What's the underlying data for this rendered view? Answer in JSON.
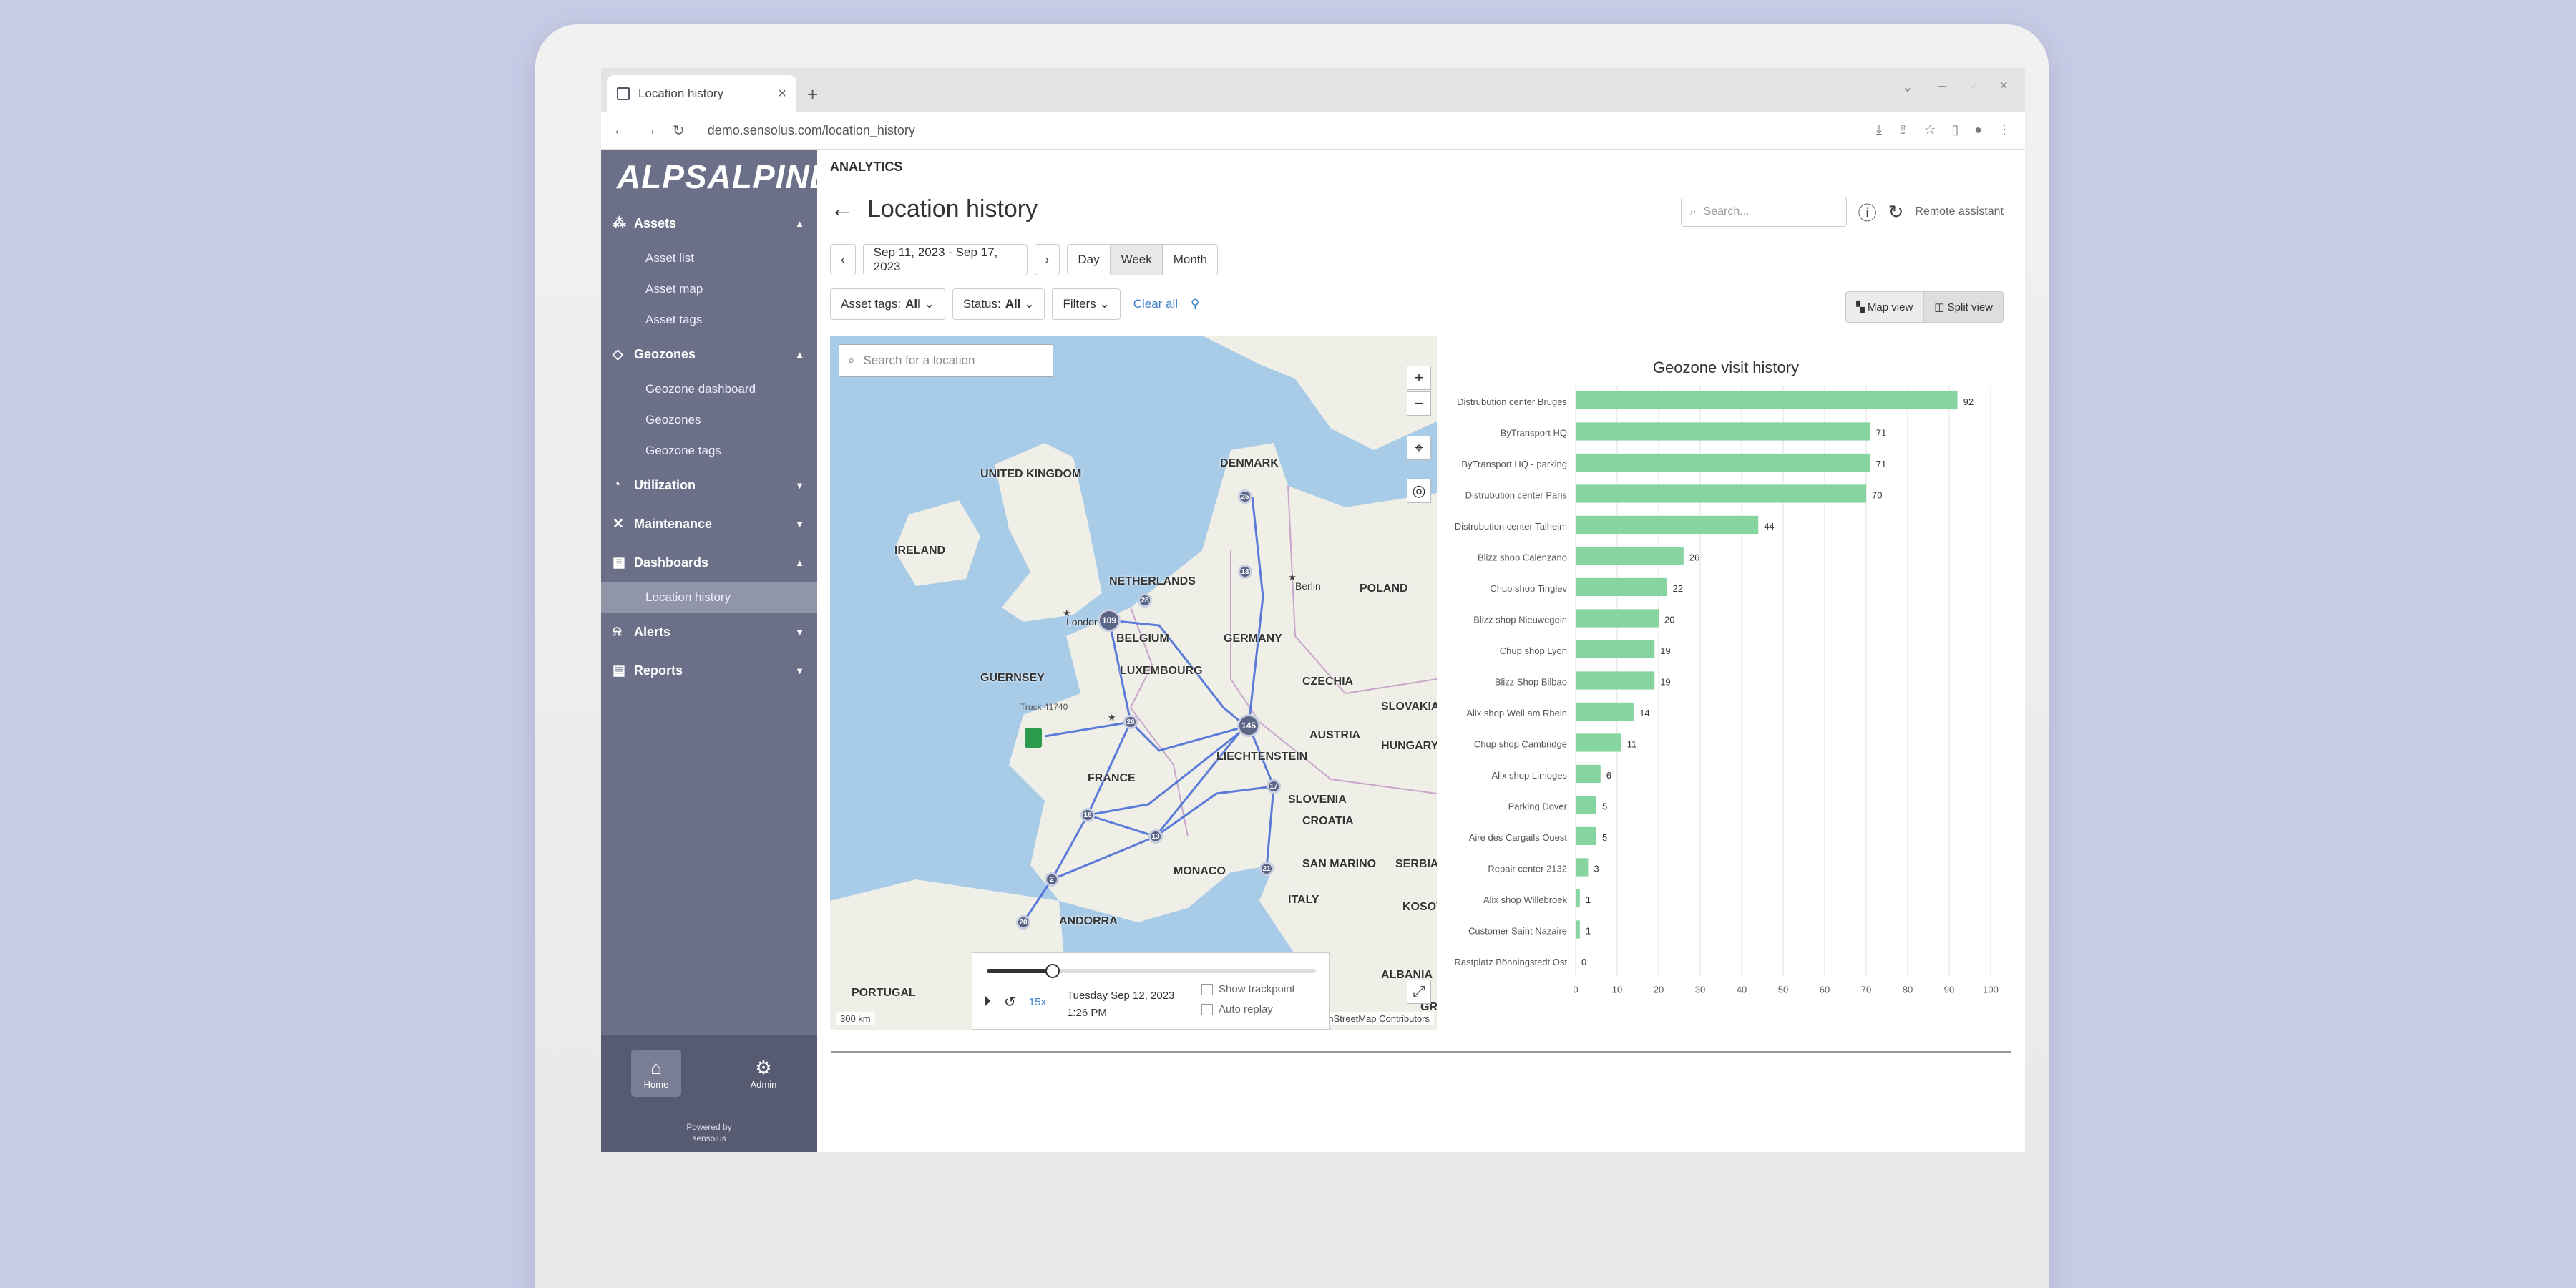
{
  "browser": {
    "tab_title": "Location history",
    "url": "demo.sensolus.com/location_history"
  },
  "sidebar": {
    "logo": "ALPSALPINE",
    "sections": [
      {
        "label": "Assets",
        "icon": "assets-icon",
        "items": [
          "Asset list",
          "Asset map",
          "Asset tags"
        ]
      },
      {
        "label": "Geozones",
        "icon": "geozone-icon",
        "items": [
          "Geozone dashboard",
          "Geozones",
          "Geozone tags"
        ]
      },
      {
        "label": "Utilization",
        "icon": "utilization-icon",
        "items": []
      },
      {
        "label": "Maintenance",
        "icon": "wrench-icon",
        "items": []
      },
      {
        "label": "Dashboards",
        "icon": "dashboard-icon",
        "items": [
          "Location history"
        ]
      },
      {
        "label": "Alerts",
        "icon": "bell-icon",
        "items": []
      },
      {
        "label": "Reports",
        "icon": "report-icon",
        "items": []
      }
    ],
    "home_label": "Home",
    "admin_label": "Admin",
    "powered_line1": "Powered by",
    "powered_line2": "sensolus"
  },
  "header": {
    "app_title": "ANALYTICS",
    "page_title": "Location history",
    "search_placeholder": "Search...",
    "remote_assistant": "Remote assistant"
  },
  "toolbar": {
    "date_range": "Sep 11, 2023 - Sep 17, 2023",
    "prev": "‹",
    "next": "›",
    "periods": [
      "Day",
      "Week",
      "Month"
    ],
    "active_period": "Week",
    "asset_tags_label": "Asset tags:",
    "asset_tags_value": "All",
    "status_label": "Status:",
    "status_value": "All",
    "filters_label": "Filters",
    "clear_all": "Clear all",
    "map_view": "Map view",
    "split_view": "Split view"
  },
  "map": {
    "search_placeholder": "Search for a location",
    "scale": "300 km",
    "attribution": "penStreetMap Contributors",
    "truck_label": "Truck 41740",
    "labels": [
      "UNITED KINGDOM",
      "IRELAND",
      "DENMARK",
      "NETHERLANDS",
      "BELGIUM",
      "LUXEMBOURG",
      "GERMANY",
      "POLAND",
      "CZECHIA",
      "SLOVAKIA",
      "AUSTRIA",
      "HUNGARY",
      "LIECHTENSTEIN",
      "SLOVENIA",
      "CROATIA",
      "FRANCE",
      "MONACO",
      "SAN MARINO",
      "ITALY",
      "SERBIA",
      "KOSOVO",
      "ALBANIA",
      "ANDORRA",
      "PORTUGAL",
      "GUERNSEY",
      "London",
      "Berlin",
      "GRE"
    ],
    "clusters": [
      "109",
      "145",
      "28",
      "13",
      "25",
      "16",
      "13",
      "17",
      "21",
      "2",
      "5",
      "20",
      "26"
    ],
    "replay": {
      "date": "Tuesday Sep 12, 2023",
      "time": "1:26 PM",
      "speed": "15x",
      "progress": 0.2,
      "show_trackpoint": "Show trackpoint",
      "auto_replay": "Auto replay"
    }
  },
  "chart_data": {
    "type": "bar",
    "orientation": "horizontal",
    "title": "Geozone visit history",
    "categories": [
      "Distrubution center Bruges",
      "ByTransport HQ",
      "ByTransport HQ - parking",
      "Distrubution center Paris",
      "Distrubution center Talheim",
      "Blizz shop Calenzano",
      "Chup shop Tinglev",
      "Blizz shop Nieuwegein",
      "Chup shop Lyon",
      "Blizz Shop Bilbao",
      "Alix shop Weil am Rhein",
      "Chup shop Cambridge",
      "Alix shop Limoges",
      "Parking Dover",
      "Aire des Cargails Ouest",
      "Repair center 2132",
      "Alix shop Willebroek",
      "Customer Saint Nazaire",
      "Rastplatz Bönningstedt Ost"
    ],
    "values": [
      92,
      71,
      71,
      70,
      44,
      26,
      22,
      20,
      19,
      19,
      14,
      11,
      6,
      5,
      5,
      3,
      1,
      1,
      0
    ],
    "xlim": [
      0,
      100
    ],
    "xticks": [
      "0",
      "10",
      "20",
      "30",
      "40",
      "50",
      "60",
      "70",
      "80",
      "90",
      "100"
    ],
    "bar_color": "#86d5a0",
    "grid": true
  }
}
